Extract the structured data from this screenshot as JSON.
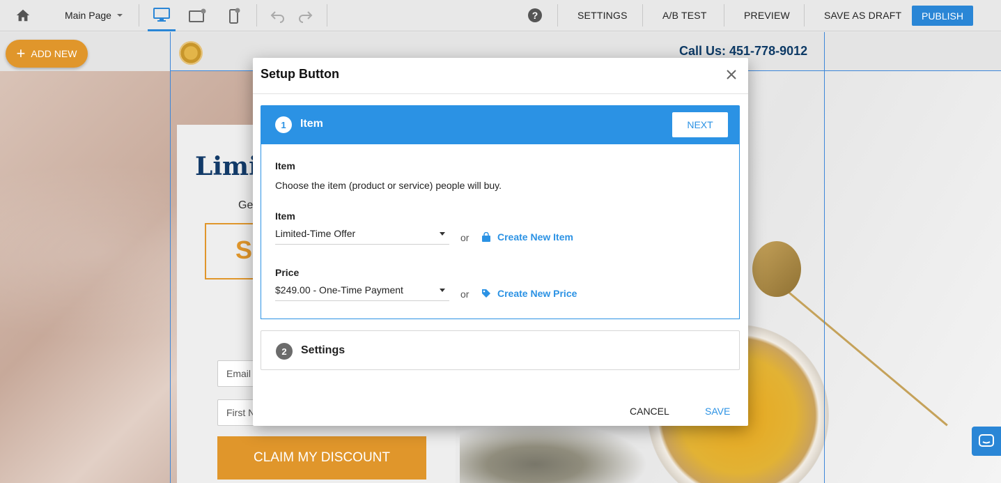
{
  "toolbar": {
    "page_select": "Main Page",
    "settings": "SETTINGS",
    "ab_test": "A/B TEST",
    "preview": "PREVIEW",
    "save_draft": "SAVE AS DRAFT",
    "publish": "PUBLISH",
    "help": "?"
  },
  "canvas": {
    "add_new": "ADD NEW",
    "call_us": "Call Us: 451-778-9012",
    "offer_title": "Limi",
    "offer_subtitle": "Ge",
    "offer_box_text": "S",
    "email_placeholder": "Email",
    "first_name_placeholder": "First N",
    "claim_button": "CLAIM MY DISCOUNT"
  },
  "modal": {
    "title": "Setup Button",
    "step1": {
      "number": "1",
      "label": "Item",
      "next": "NEXT",
      "section_label": "Item",
      "description": "Choose the item (product or service) people will buy.",
      "item_label": "Item",
      "item_value": "Limited-Time Offer",
      "or_text": "or",
      "create_item": "Create New Item",
      "price_label": "Price",
      "price_value": "$249.00 - One-Time Payment",
      "create_price": "Create New Price"
    },
    "step2": {
      "number": "2",
      "label": "Settings"
    },
    "cancel": "CANCEL",
    "save": "SAVE"
  },
  "colors": {
    "accent_blue": "#2b92e4",
    "orange": "#e0962b",
    "navy": "#123a68"
  }
}
